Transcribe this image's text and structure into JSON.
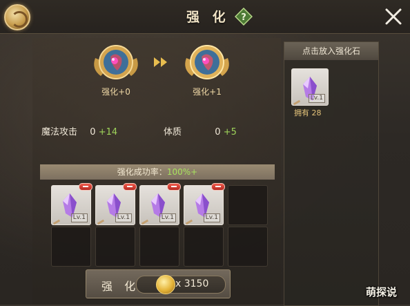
{
  "header": {
    "title": "强 化",
    "help_icon": "help-diamond-icon",
    "close_icon": "close-icon"
  },
  "upgrade": {
    "current_label": "强化+0",
    "next_label": "强化+1"
  },
  "stats": [
    {
      "name": "魔法攻击",
      "base": "0",
      "bonus": "+14"
    },
    {
      "name": "体质",
      "base": "0",
      "bonus": "+5"
    }
  ],
  "success_rate": {
    "label": "强化成功率：",
    "value": "100%+"
  },
  "slots": [
    {
      "filled": true,
      "level": "Lv.1"
    },
    {
      "filled": true,
      "level": "Lv.1"
    },
    {
      "filled": true,
      "level": "Lv.1"
    },
    {
      "filled": true,
      "level": "Lv.1"
    },
    {
      "filled": false
    },
    {
      "filled": false
    },
    {
      "filled": false
    },
    {
      "filled": false
    },
    {
      "filled": false
    },
    {
      "filled": false
    }
  ],
  "enhance_button": {
    "label": "强 化",
    "cost": "x 3150"
  },
  "stone_panel": {
    "header": "点击放入强化石",
    "level": "Lv.1",
    "owned": "拥有 28"
  },
  "watermark": "萌探说",
  "colors": {
    "accent_green": "#9ed35a",
    "gold_text": "#e4c37a"
  }
}
